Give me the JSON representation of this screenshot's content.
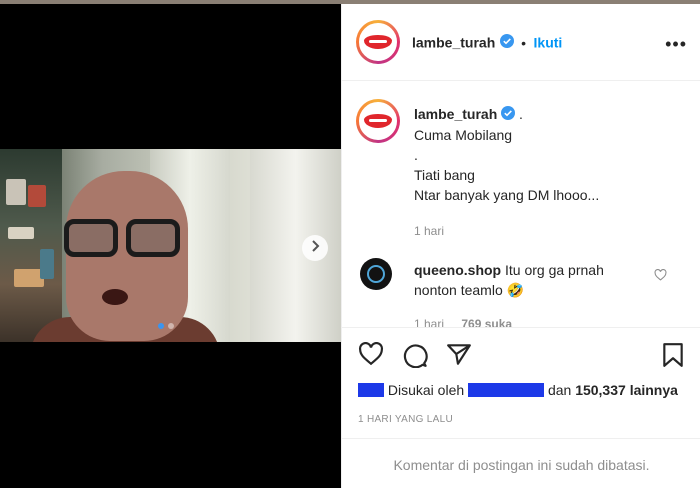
{
  "post": {
    "author": "lambe_turah",
    "follow_separator": "•",
    "follow_label": "Ikuti",
    "more_label": "•••",
    "avatar_text": "LAMBE TURAH",
    "caption_dot": ".",
    "caption_lines": [
      "Cuma Mobilang",
      ".",
      "Tiati bang",
      "Ntar banyak yang DM lhooo..."
    ],
    "caption_age": "1 hari"
  },
  "media": {
    "carousel_dots": 2,
    "active_dot": 1
  },
  "comment": {
    "username": "queeno.shop",
    "text": "Itu org ga prnah nonton teamlo 🤣",
    "age": "1 hari",
    "likes": "769 suka"
  },
  "engagement": {
    "liked_by_prefix": "Disukai oleh",
    "liked_by_and": "dan",
    "likes_count": "150,337",
    "likes_suffix": "lainnya",
    "date": "1 HARI YANG LALU",
    "comments_restricted": "Komentar di postingan ini sudah dibatasi."
  },
  "colors": {
    "accent": "#0095f6",
    "verified": "#3897f0",
    "muted": "#8e8e8e",
    "text": "#262626",
    "redaction": "#1d39e8"
  },
  "icons": [
    "verified-badge-icon",
    "more-options-icon",
    "heart-icon",
    "comment-icon",
    "share-icon",
    "bookmark-icon",
    "carousel-next-icon"
  ]
}
